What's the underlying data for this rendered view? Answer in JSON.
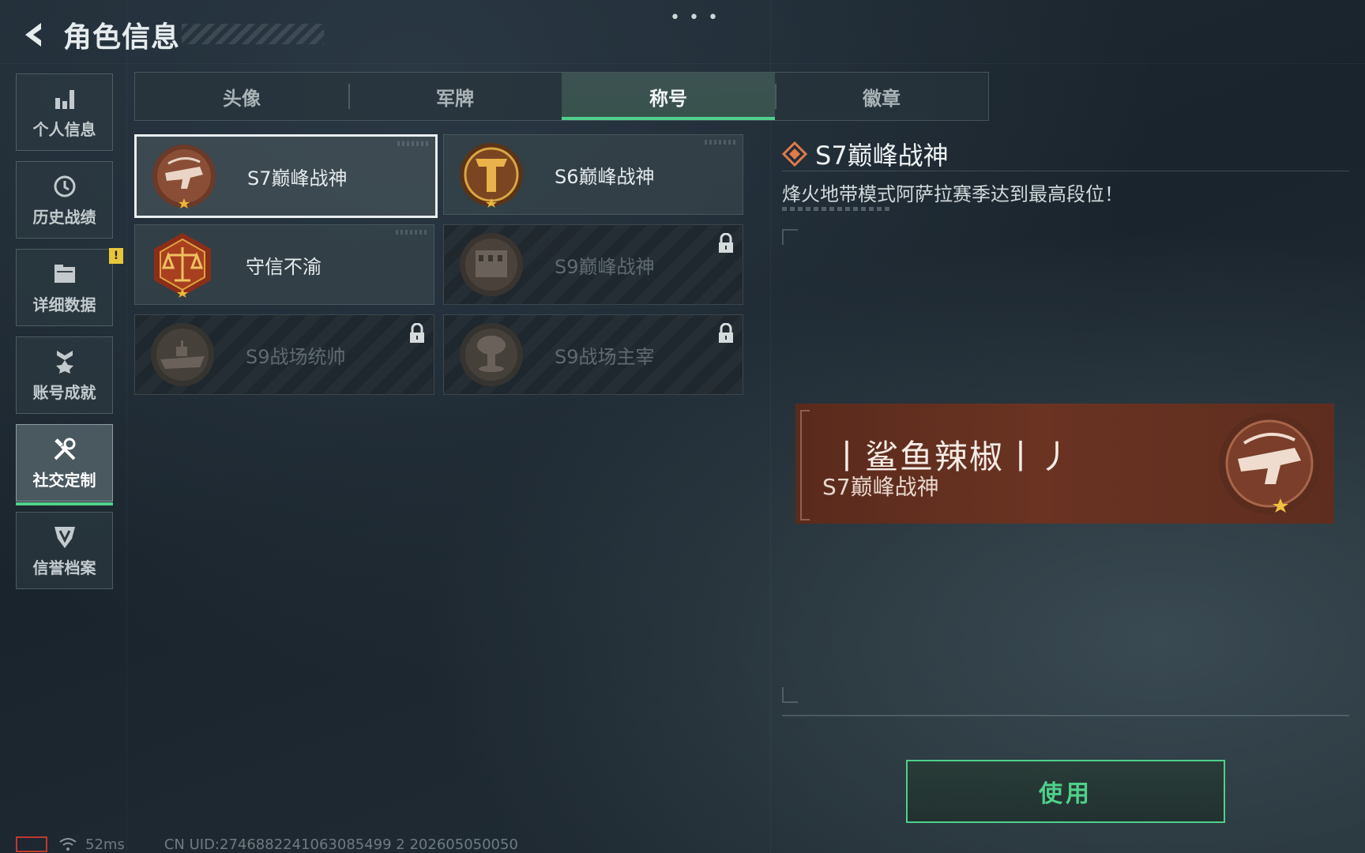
{
  "header": {
    "title": "角色信息",
    "more_dots": "• • •"
  },
  "sidebar": {
    "items": [
      {
        "label": "个人信息",
        "icon": "bar-chart-icon"
      },
      {
        "label": "历史战绩",
        "icon": "history-clock-icon"
      },
      {
        "label": "详细数据",
        "icon": "folder-icon",
        "badge": "!"
      },
      {
        "label": "账号成就",
        "icon": "medal-icon"
      },
      {
        "label": "社交定制",
        "icon": "tools-icon",
        "active": true
      },
      {
        "label": "信誉档案",
        "icon": "shield-icon"
      }
    ]
  },
  "tabs": [
    {
      "label": "头像"
    },
    {
      "label": "军牌"
    },
    {
      "label": "称号",
      "active": true
    },
    {
      "label": "徽章"
    }
  ],
  "titles": [
    {
      "name": "S7巅峰战神",
      "selected": true,
      "locked": false,
      "medal": "bronze-pistol-medal"
    },
    {
      "name": "S6巅峰战神",
      "selected": false,
      "locked": false,
      "medal": "gold-t-medal"
    },
    {
      "name": "守信不渝",
      "selected": false,
      "locked": false,
      "medal": "justice-scale-medal"
    },
    {
      "name": "S9巅峰战神",
      "selected": false,
      "locked": true,
      "medal": "building-medal"
    },
    {
      "name": "S9战场统帅",
      "selected": false,
      "locked": true,
      "medal": "warship-medal"
    },
    {
      "name": "S9战场主宰",
      "selected": false,
      "locked": true,
      "medal": "mushroom-cloud-medal"
    }
  ],
  "detail": {
    "title": "S7巅峰战神",
    "description": "烽火地带模式阿萨拉赛季达到最高段位！"
  },
  "preview": {
    "player_name": "丨鲨鱼辣椒丨丿",
    "title": "S7巅峰战神"
  },
  "use_button": "使用",
  "status_bar": {
    "ping": "52ms",
    "uid": "CN UID:2746882241063085499 2 202605050050"
  },
  "colors": {
    "accent": "#4fd08a",
    "banner": "#6a3322",
    "selected_border": "#e9eef0"
  }
}
